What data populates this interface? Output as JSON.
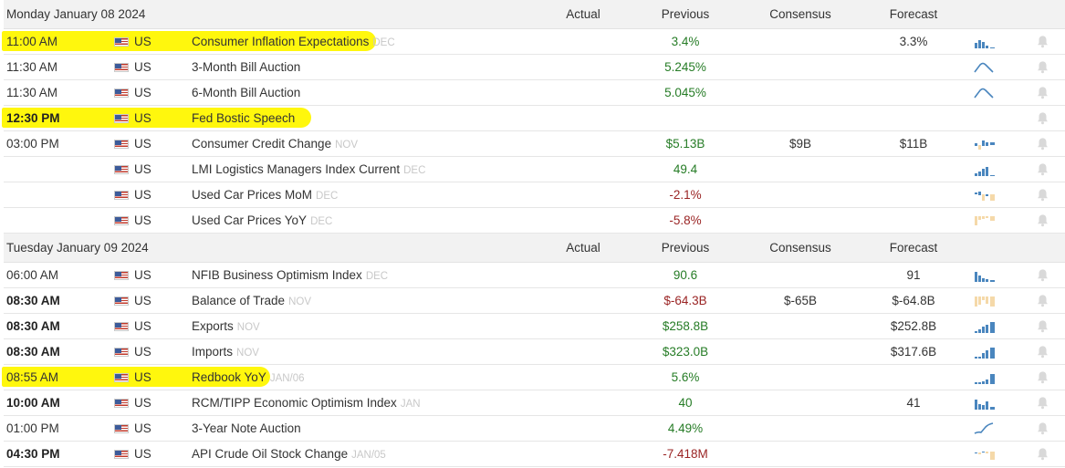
{
  "columns": {
    "actual": "Actual",
    "previous": "Previous",
    "consensus": "Consensus",
    "forecast": "Forecast"
  },
  "days": [
    {
      "date": "Monday January 08 2024",
      "events": [
        {
          "time": "11:00 AM",
          "bold": false,
          "highlight": true,
          "country": "US",
          "event": "Consumer Inflation Expectations",
          "period": "DEC",
          "actual": "",
          "previous": "3.4%",
          "prev_color": "pos",
          "consensus": "",
          "forecast": "3.3%",
          "spark": "bars-blue-1"
        },
        {
          "time": "11:30 AM",
          "bold": false,
          "highlight": false,
          "country": "US",
          "event": "3-Month Bill Auction",
          "period": "",
          "actual": "",
          "previous": "5.245%",
          "prev_color": "pos",
          "consensus": "",
          "forecast": "",
          "spark": "line-peak"
        },
        {
          "time": "11:30 AM",
          "bold": false,
          "highlight": false,
          "country": "US",
          "event": "6-Month Bill Auction",
          "period": "",
          "actual": "",
          "previous": "5.045%",
          "prev_color": "pos",
          "consensus": "",
          "forecast": "",
          "spark": "line-peak"
        },
        {
          "time": "12:30 PM",
          "bold": true,
          "highlight": true,
          "country": "US",
          "event": "Fed Bostic Speech",
          "period": "",
          "actual": "",
          "previous": "",
          "prev_color": "neu",
          "consensus": "",
          "forecast": "",
          "spark": "none"
        },
        {
          "time": "03:00 PM",
          "bold": false,
          "highlight": false,
          "country": "US",
          "event": "Consumer Credit Change",
          "period": "NOV",
          "actual": "",
          "previous": "$5.13B",
          "prev_color": "pos",
          "consensus": "$9B",
          "forecast": "$11B",
          "spark": "bars-mixed-1"
        },
        {
          "time": "",
          "bold": false,
          "highlight": false,
          "country": "US",
          "event": "LMI Logistics Managers Index Current",
          "period": "DEC",
          "actual": "",
          "previous": "49.4",
          "prev_color": "pos",
          "consensus": "",
          "forecast": "",
          "spark": "bars-blue-2"
        },
        {
          "time": "",
          "bold": false,
          "highlight": false,
          "country": "US",
          "event": "Used Car Prices MoM",
          "period": "DEC",
          "actual": "",
          "previous": "-2.1%",
          "prev_color": "neg",
          "consensus": "",
          "forecast": "",
          "spark": "bars-mixed-2"
        },
        {
          "time": "",
          "bold": false,
          "highlight": false,
          "country": "US",
          "event": "Used Car Prices YoY",
          "period": "DEC",
          "actual": "",
          "previous": "-5.8%",
          "prev_color": "neg",
          "consensus": "",
          "forecast": "",
          "spark": "bars-peach-1"
        }
      ]
    },
    {
      "date": "Tuesday January 09 2024",
      "events": [
        {
          "time": "06:00 AM",
          "bold": false,
          "highlight": false,
          "country": "US",
          "event": "NFIB Business Optimism Index",
          "period": "DEC",
          "actual": "",
          "previous": "90.6",
          "prev_color": "pos",
          "consensus": "",
          "forecast": "91",
          "spark": "bars-blue-3"
        },
        {
          "time": "08:30 AM",
          "bold": true,
          "highlight": false,
          "country": "US",
          "event": "Balance of Trade",
          "period": "NOV",
          "actual": "",
          "previous": "$-64.3B",
          "prev_color": "neg",
          "consensus": "$-65B",
          "forecast": "$-64.8B",
          "spark": "bars-peach-2"
        },
        {
          "time": "08:30 AM",
          "bold": true,
          "highlight": false,
          "country": "US",
          "event": "Exports",
          "period": "NOV",
          "actual": "",
          "previous": "$258.8B",
          "prev_color": "pos",
          "consensus": "",
          "forecast": "$252.8B",
          "spark": "bars-blue-4"
        },
        {
          "time": "08:30 AM",
          "bold": true,
          "highlight": false,
          "country": "US",
          "event": "Imports",
          "period": "NOV",
          "actual": "",
          "previous": "$323.0B",
          "prev_color": "pos",
          "consensus": "",
          "forecast": "$317.6B",
          "spark": "bars-blue-5"
        },
        {
          "time": "08:55 AM",
          "bold": false,
          "highlight": true,
          "country": "US",
          "event": "Redbook YoY",
          "period": "JAN/06",
          "actual": "",
          "previous": "5.6%",
          "prev_color": "pos",
          "consensus": "",
          "forecast": "",
          "spark": "bars-blue-6"
        },
        {
          "time": "10:00 AM",
          "bold": true,
          "highlight": false,
          "country": "US",
          "event": "RCM/TIPP Economic Optimism Index",
          "period": "JAN",
          "actual": "",
          "previous": "40",
          "prev_color": "pos",
          "consensus": "",
          "forecast": "41",
          "spark": "bars-blue-7"
        },
        {
          "time": "01:00 PM",
          "bold": false,
          "highlight": false,
          "country": "US",
          "event": "3-Year Note Auction",
          "period": "",
          "actual": "",
          "previous": "4.49%",
          "prev_color": "pos",
          "consensus": "",
          "forecast": "",
          "spark": "line-rise"
        },
        {
          "time": "04:30 PM",
          "bold": true,
          "highlight": false,
          "country": "US",
          "event": "API Crude Oil Stock Change",
          "period": "JAN/05",
          "actual": "",
          "previous": "-7.418M",
          "prev_color": "neg",
          "consensus": "",
          "forecast": "",
          "spark": "bars-mixed-3"
        }
      ]
    }
  ],
  "colors": {
    "positive": "#267c26",
    "negative": "#9a2424",
    "spark_blue": "#4a86be",
    "spark_peach": "#f5d9a9",
    "highlight": "#fff700",
    "bell": "#d9d9d9"
  },
  "icons": {
    "flag": "us-flag-icon",
    "alert": "bell-icon"
  }
}
